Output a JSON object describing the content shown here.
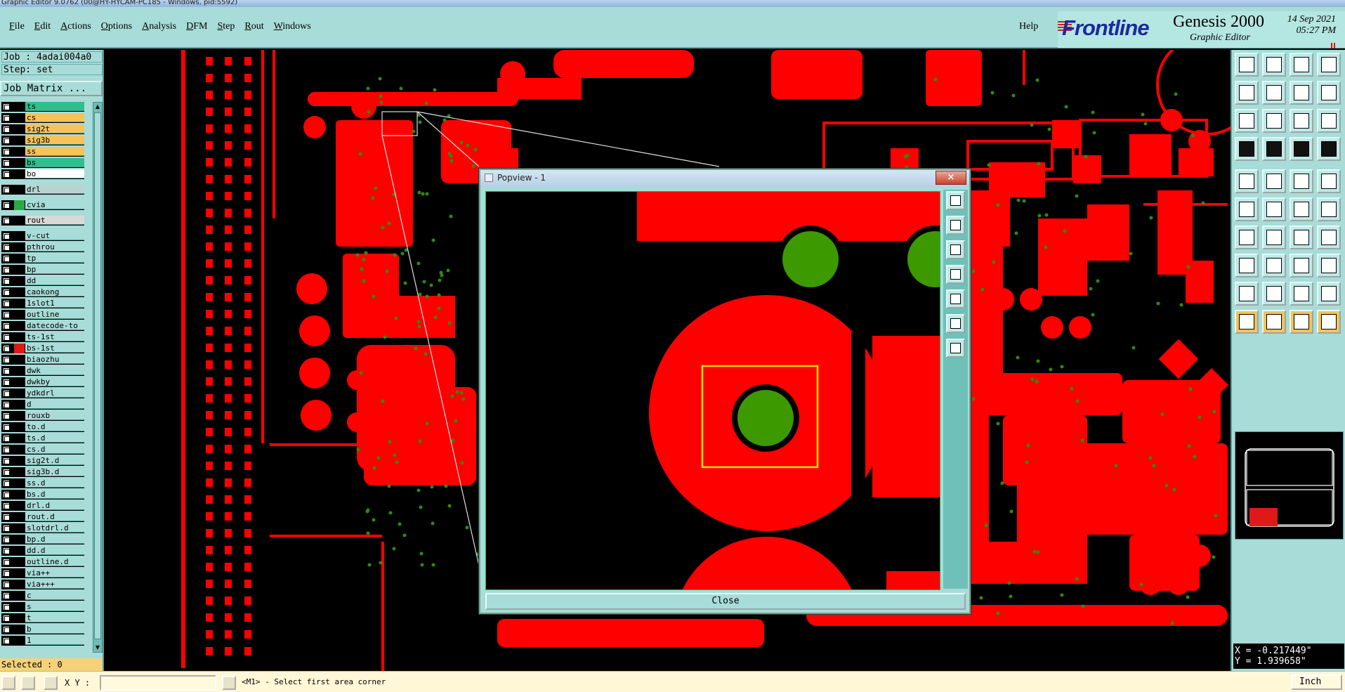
{
  "window": {
    "title": "Graphic Editor 9.0762 (00@HY-HYCAM-PC185 - Windows, pid:5592)"
  },
  "menubar": {
    "items": [
      {
        "label": "File",
        "mnemonic": "F",
        "rest": "ile"
      },
      {
        "label": "Edit",
        "mnemonic": "E",
        "rest": "dit"
      },
      {
        "label": "Actions",
        "mnemonic": "A",
        "rest": "ctions"
      },
      {
        "label": "Options",
        "mnemonic": "O",
        "rest": "ptions"
      },
      {
        "label": "Analysis",
        "mnemonic": "A",
        "rest": "nalysis"
      },
      {
        "label": "DFM",
        "mnemonic": "D",
        "rest": "FM"
      },
      {
        "label": "Step",
        "mnemonic": "S",
        "rest": "tep"
      },
      {
        "label": "Rout",
        "mnemonic": "R",
        "rest": "out"
      },
      {
        "label": "Windows",
        "mnemonic": "W",
        "rest": "indows"
      }
    ],
    "help": "Help"
  },
  "brand": {
    "logo": "Frontline",
    "product": "Genesis 2000",
    "subtitle": "Graphic Editor",
    "date": "14 Sep 2021",
    "time": "05:27 PM"
  },
  "left_panel": {
    "job": "Job : 4adai004a0",
    "step": "Step: set",
    "job_matrix_button": "Job Matrix ...",
    "selected": "Selected : 0",
    "layers": [
      {
        "name": "ts",
        "bg": "#2fbf8c",
        "ind": "#000000"
      },
      {
        "name": "cs",
        "bg": "#f5c35a",
        "ind": "#000000"
      },
      {
        "name": "sig2t",
        "bg": "#f5c35a",
        "ind": "#000000"
      },
      {
        "name": "sig3b",
        "bg": "#f5c35a",
        "ind": "#000000"
      },
      {
        "name": "ss",
        "bg": "#f5c35a",
        "ind": "#000000"
      },
      {
        "name": "bs",
        "bg": "#2fbf8c",
        "ind": "#000000"
      },
      {
        "name": "bo",
        "bg": "#ffffff",
        "ind": "#000000"
      },
      {
        "name": "drl",
        "bg": "#b8d4d2",
        "ind": "#000000"
      },
      {
        "name": "cvia",
        "bg": "#a8dcd8",
        "ind": "#2aa84a"
      },
      {
        "name": "rout",
        "bg": "#d8d8d8",
        "ind": "#000000"
      },
      {
        "name": "v-cut",
        "bg": "#a8dcd8",
        "ind": "#000000"
      },
      {
        "name": "pthrou",
        "bg": "#a8dcd8",
        "ind": "#000000"
      },
      {
        "name": "tp",
        "bg": "#a8dcd8",
        "ind": "#000000"
      },
      {
        "name": "bp",
        "bg": "#a8dcd8",
        "ind": "#000000"
      },
      {
        "name": "dd",
        "bg": "#a8dcd8",
        "ind": "#000000"
      },
      {
        "name": "caokong",
        "bg": "#a8dcd8",
        "ind": "#000000"
      },
      {
        "name": "1slot1",
        "bg": "#a8dcd8",
        "ind": "#000000"
      },
      {
        "name": "outline",
        "bg": "#a8dcd8",
        "ind": "#000000"
      },
      {
        "name": "datecode-to",
        "bg": "#a8dcd8",
        "ind": "#000000"
      },
      {
        "name": "ts-1st",
        "bg": "#a8dcd8",
        "ind": "#000000"
      },
      {
        "name": "bs-1st",
        "bg": "#a8dcd8",
        "ind": "#e01818"
      },
      {
        "name": "biaozhu",
        "bg": "#a8dcd8",
        "ind": "#000000"
      },
      {
        "name": "dwk",
        "bg": "#a8dcd8",
        "ind": "#000000"
      },
      {
        "name": "dwkby",
        "bg": "#a8dcd8",
        "ind": "#000000"
      },
      {
        "name": "ydkdrl",
        "bg": "#a8dcd8",
        "ind": "#000000"
      },
      {
        "name": "d",
        "bg": "#a8dcd8",
        "ind": "#000000"
      },
      {
        "name": "rouxb",
        "bg": "#a8dcd8",
        "ind": "#000000"
      },
      {
        "name": "to.d",
        "bg": "#a8dcd8",
        "ind": "#000000"
      },
      {
        "name": "ts.d",
        "bg": "#a8dcd8",
        "ind": "#000000"
      },
      {
        "name": "cs.d",
        "bg": "#a8dcd8",
        "ind": "#000000"
      },
      {
        "name": "sig2t.d",
        "bg": "#a8dcd8",
        "ind": "#000000"
      },
      {
        "name": "sig3b.d",
        "bg": "#a8dcd8",
        "ind": "#000000"
      },
      {
        "name": "ss.d",
        "bg": "#a8dcd8",
        "ind": "#000000"
      },
      {
        "name": "bs.d",
        "bg": "#a8dcd8",
        "ind": "#000000"
      },
      {
        "name": "drl.d",
        "bg": "#a8dcd8",
        "ind": "#000000"
      },
      {
        "name": "rout.d",
        "bg": "#a8dcd8",
        "ind": "#000000"
      },
      {
        "name": "slotdrl.d",
        "bg": "#a8dcd8",
        "ind": "#000000"
      },
      {
        "name": "bp.d",
        "bg": "#a8dcd8",
        "ind": "#000000"
      },
      {
        "name": "dd.d",
        "bg": "#a8dcd8",
        "ind": "#000000"
      },
      {
        "name": "outline.d",
        "bg": "#a8dcd8",
        "ind": "#000000"
      },
      {
        "name": "via++",
        "bg": "#a8dcd8",
        "ind": "#000000"
      },
      {
        "name": "via+++",
        "bg": "#a8dcd8",
        "ind": "#000000"
      },
      {
        "name": "c",
        "bg": "#a8dcd8",
        "ind": "#000000"
      },
      {
        "name": "s",
        "bg": "#a8dcd8",
        "ind": "#000000"
      },
      {
        "name": "t",
        "bg": "#a8dcd8",
        "ind": "#000000"
      },
      {
        "name": "b",
        "bg": "#a8dcd8",
        "ind": "#000000"
      },
      {
        "name": "1",
        "bg": "#a8dcd8",
        "ind": "#000000"
      }
    ]
  },
  "popview": {
    "title": "Popview - 1",
    "close_label": "Close",
    "close_x": "×"
  },
  "right_panel": {
    "tools": [
      "zoom-tool",
      "pan-tool",
      "home-tool",
      "fit-tool",
      "back-tool",
      "forward-tool",
      "redraw-tool",
      "split-tool",
      "measure-tool",
      "center-tool",
      "scale-tool",
      "help-tool",
      "filter-tool",
      "ruler-tool",
      "net-tool",
      "net2-tool",
      "snap-tool",
      "draw-tool",
      "grid-tool",
      "pad-tool",
      "node-tool",
      "cross-tool",
      "line-tool",
      "arc-tool",
      "angle-tool",
      "slash-tool",
      "arc2-tool",
      "ff-tool",
      "join-tool",
      "minus-tool",
      "frame-tool",
      "comp-tool",
      "tri-tool",
      "tri2-tool",
      "tri3-tool",
      "tri4-tool",
      "pointer-tool",
      "pointer2-tool",
      "pointer3-tool",
      "pointer4-tool"
    ],
    "coord_x": "X = -0.217449\"",
    "coord_y": "Y = 1.939658\""
  },
  "statusbar": {
    "xy_label": "X Y :",
    "xy_value": "",
    "prompt": "<M1> - Select first area corner",
    "units": "Inch"
  },
  "colors": {
    "copper": "#ff0000",
    "via": "#2e8b0c",
    "highlight": "#e8e800",
    "panel": "#a8dcd8"
  }
}
